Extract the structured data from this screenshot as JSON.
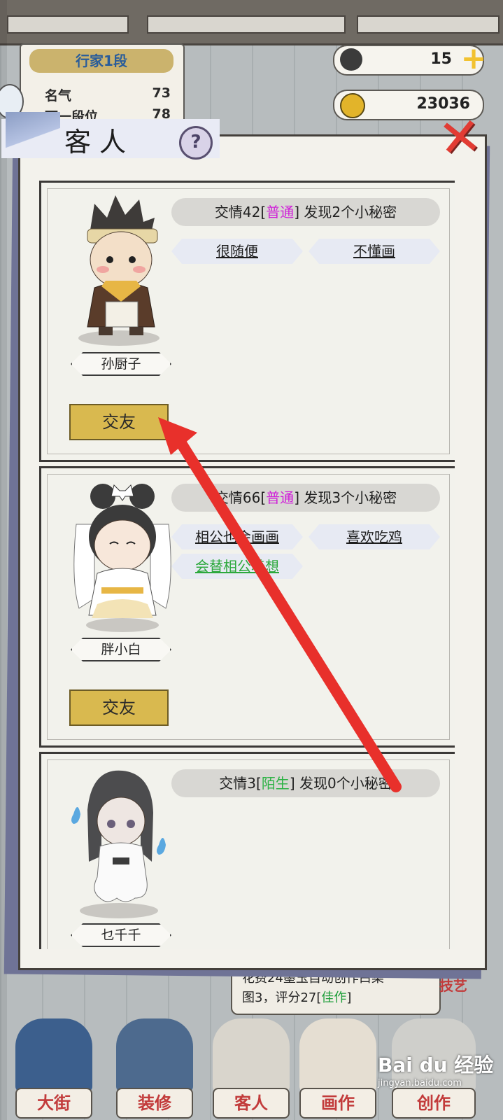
{
  "hud": {
    "rank_title": "行家1段",
    "fame_label": "名气",
    "fame_value": "73",
    "next_rank_label": "下一段位",
    "next_rank_value": "78",
    "jade_count": "15",
    "coin_count": "23036"
  },
  "dialog": {
    "title": "客人",
    "help_label": "?",
    "close_label": "✕"
  },
  "guests": [
    {
      "name": "孙厨子",
      "affinity_prefix": "交情42[",
      "affinity_level": "普通",
      "affinity_suffix": "] 发现2个小秘密",
      "secrets": [
        "很随便",
        "不懂画"
      ],
      "friend_button": "交友"
    },
    {
      "name": "胖小白",
      "affinity_prefix": "交情66[",
      "affinity_level": "普通",
      "affinity_suffix": "] 发现3个小秘密",
      "secrets": [
        "相公也会画画",
        "喜欢吃鸡",
        "会替相公着想"
      ],
      "friend_button": "交友"
    },
    {
      "name": "乜千千",
      "affinity_prefix": "交情3[",
      "affinity_level": "陌生",
      "affinity_suffix": "] 发现0个小秘密"
    }
  ],
  "notice": {
    "line1": "花费24墨玉自动创作白菜",
    "line2_prefix": "图3，评分27[",
    "line2_grade": "佳作",
    "line2_suffix": "]",
    "skill_tag": "技艺"
  },
  "nav": {
    "street": "大街",
    "decorate": "装修",
    "guests": "客人",
    "paint": "画作",
    "create": "创作"
  },
  "watermark": {
    "brand": "Bai du 经验",
    "url": "jingyan.baidu.com"
  },
  "colors": {
    "level_normal": "#d020d8",
    "level_stranger": "#2cb244",
    "friend_button": "#d9b94f",
    "close_x": "#e23c34",
    "arrow": "#e8302b"
  }
}
